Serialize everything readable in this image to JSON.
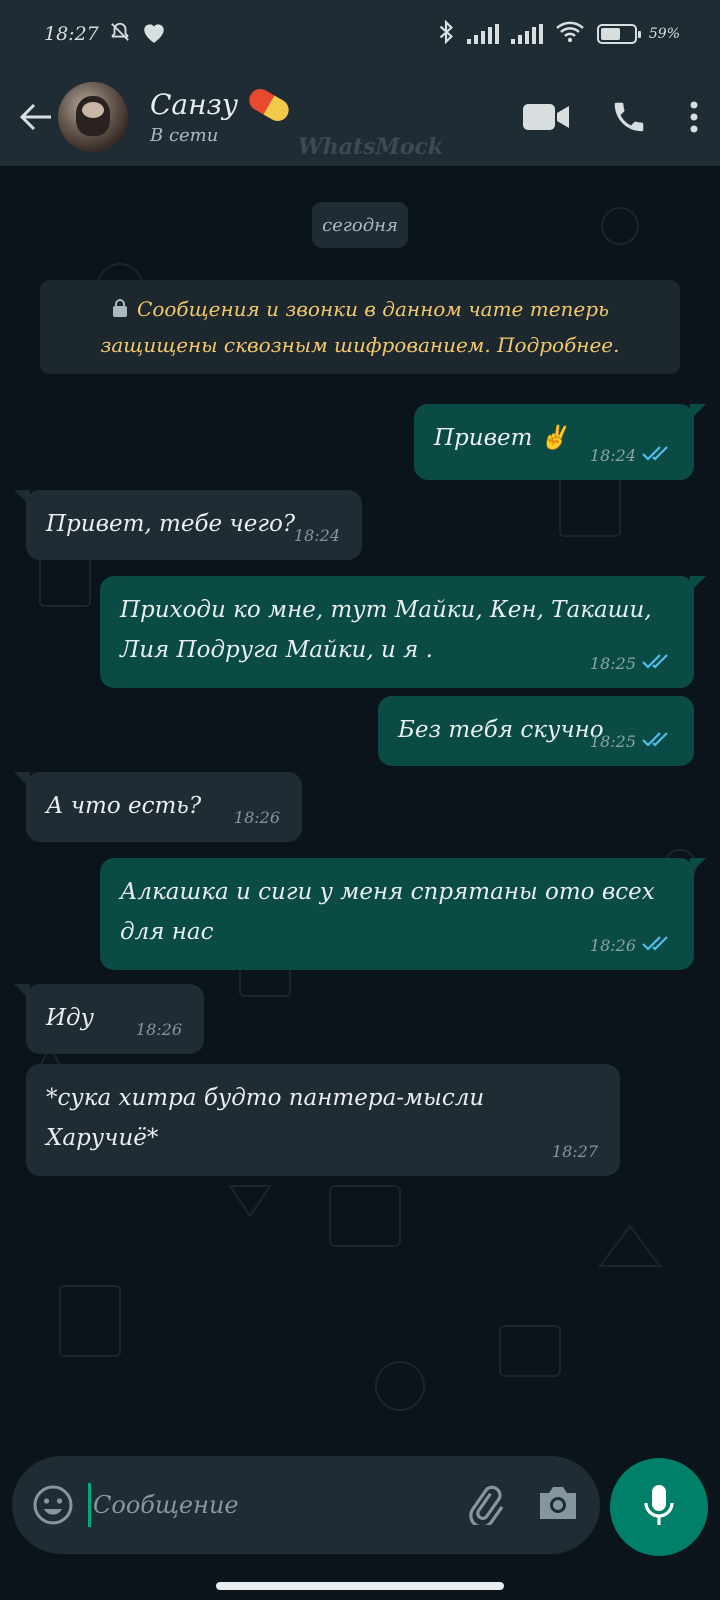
{
  "status_bar": {
    "time": "18:27",
    "battery_percent": "59%",
    "battery_level": 0.59
  },
  "header": {
    "contact_name": "Санзу",
    "contact_status": "В сети",
    "watermark": "WhatsMock"
  },
  "chat": {
    "date_label": "сегодня",
    "encryption_notice": "Сообщения и звонки в данном чате теперь защищены сквозным шифрованием. Подробнее.",
    "messages": [
      {
        "direction": "out",
        "text": "Привет ✌️",
        "time": "18:24",
        "read": true
      },
      {
        "direction": "in",
        "text": "Привет, тебе чего?",
        "time": "18:24"
      },
      {
        "direction": "out",
        "text": "Приходи ко мне, тут Майки, Кен, Такаши, Лия Подруга Майки, и я .",
        "time": "18:25",
        "read": true
      },
      {
        "direction": "out",
        "text": "Без тебя скучно",
        "time": "18:25",
        "read": true
      },
      {
        "direction": "in",
        "text": "А что есть?",
        "time": "18:26"
      },
      {
        "direction": "out",
        "text": "Алкашка и сиги у меня спрятаны ото всех для нас",
        "time": "18:26",
        "read": true
      },
      {
        "direction": "in",
        "text": "Иду",
        "time": "18:26"
      },
      {
        "direction": "in",
        "text": "*сука хитра будто пантера-мысли Харучиё*",
        "time": "18:27"
      }
    ]
  },
  "composer": {
    "placeholder": "Сообщение"
  },
  "icons": {
    "back": "arrow-left-icon",
    "video_call": "video-camera-icon",
    "voice_call": "phone-icon",
    "menu": "more-vertical-icon",
    "emoji": "emoji-icon",
    "attach": "paperclip-icon",
    "camera": "camera-icon",
    "mic": "microphone-icon"
  },
  "colors": {
    "background": "#0b141a",
    "header": "#1f2c34",
    "outgoing_bubble": "#0a4b45",
    "incoming_bubble": "#1f2c34",
    "accent": "#008069",
    "read_ticks": "#53bdeb",
    "notice_text": "#f2c86b"
  }
}
